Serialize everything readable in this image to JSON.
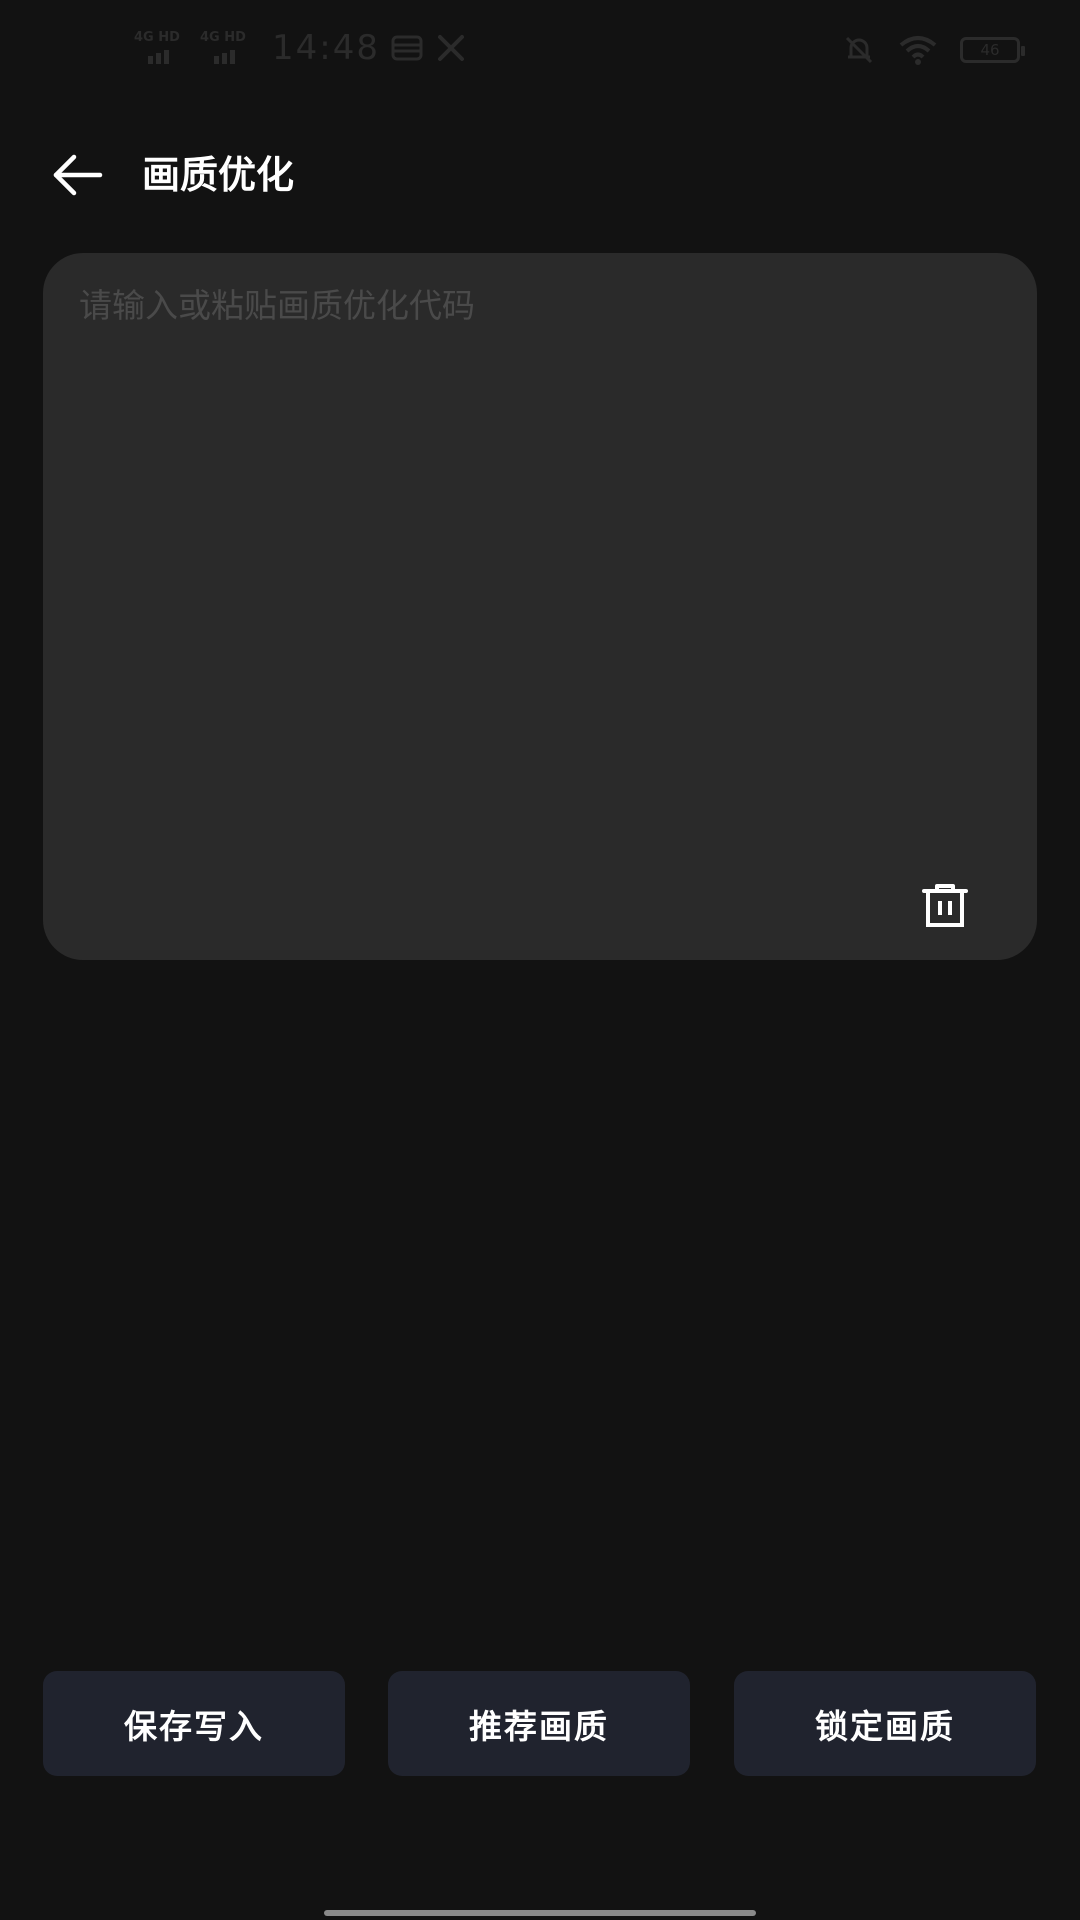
{
  "status_bar": {
    "signal_1": "4G HD",
    "signal_2": "4G HD",
    "time": "14:48",
    "battery": "46",
    "icons": [
      "sim-card-icon",
      "tools-icon",
      "mute-bell-icon",
      "wifi-icon",
      "battery-icon"
    ]
  },
  "header": {
    "title": "画质优化",
    "back_icon": "arrow-left-icon"
  },
  "editor": {
    "placeholder": "请输入或粘贴画质优化代码",
    "value": "",
    "delete_icon": "trash-icon"
  },
  "actions": {
    "save_label": "保存写入",
    "recommend_label": "推荐画质",
    "lock_label": "锁定画质"
  },
  "colors": {
    "background": "#121212",
    "card": "#2a2a2a",
    "button": "#20232e",
    "text": "#ffffff"
  }
}
